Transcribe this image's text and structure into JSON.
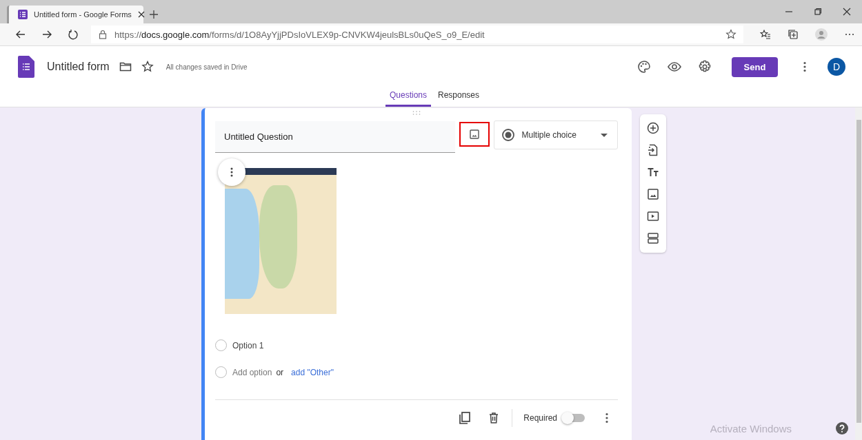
{
  "browser": {
    "tab": {
      "title": "Untitled form - Google Forms"
    },
    "url": "https://**docs.google.com**/forms/d/1O8AyYjjPDsIoVLEX9p-CNVKW4jeulsBLs0uQeS_o9_E/edit"
  },
  "header": {
    "title": "Untitled form",
    "save_status": "All changes saved in Drive",
    "send_label": "Send",
    "avatar_letter": "D"
  },
  "tabs": [
    {
      "label": "Questions",
      "selected": true
    },
    {
      "label": "Responses",
      "selected": false
    }
  ],
  "question": {
    "title": "Untitled Question",
    "image_button": {
      "highlighted": true
    },
    "type": "Multiple choice",
    "options": [
      {
        "label": "Option 1",
        "selected": false
      }
    ],
    "add_option": {
      "label": "Add option",
      "selected": false
    },
    "or": "or",
    "add_other": "add \"Other\"",
    "required": {
      "label": "Required",
      "on": false
    }
  },
  "os_notice": "Activate Windows"
}
